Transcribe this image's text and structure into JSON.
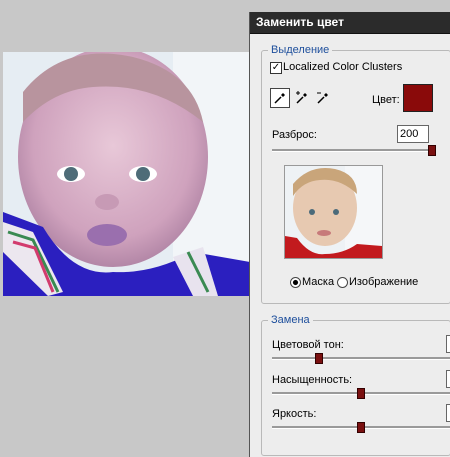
{
  "dialog": {
    "title": "Заменить цвет",
    "selection": {
      "legend": "Выделение",
      "localized_clusters_label": "Localized Color Clusters",
      "localized_clusters_checked": true,
      "color_label": "Цвет:",
      "color_swatch": "#8a0a0a",
      "fuzziness_label": "Разброс:",
      "fuzziness_value": "200",
      "fuzziness_level": 1.0,
      "mask_label": "Маска",
      "image_label": "Изображение",
      "view_mode": "mask"
    },
    "replacement": {
      "legend": "Замена",
      "hue_label": "Цветовой тон:",
      "hue_level": 0.25,
      "saturation_label": "Насыщенность:",
      "saturation_level": 0.5,
      "lightness_label": "Яркость:",
      "lightness_level": 0.5
    }
  },
  "icons": [
    "eyedropper-icon",
    "eyedropper-plus-icon",
    "eyedropper-minus-icon",
    "checkmark-icon"
  ]
}
